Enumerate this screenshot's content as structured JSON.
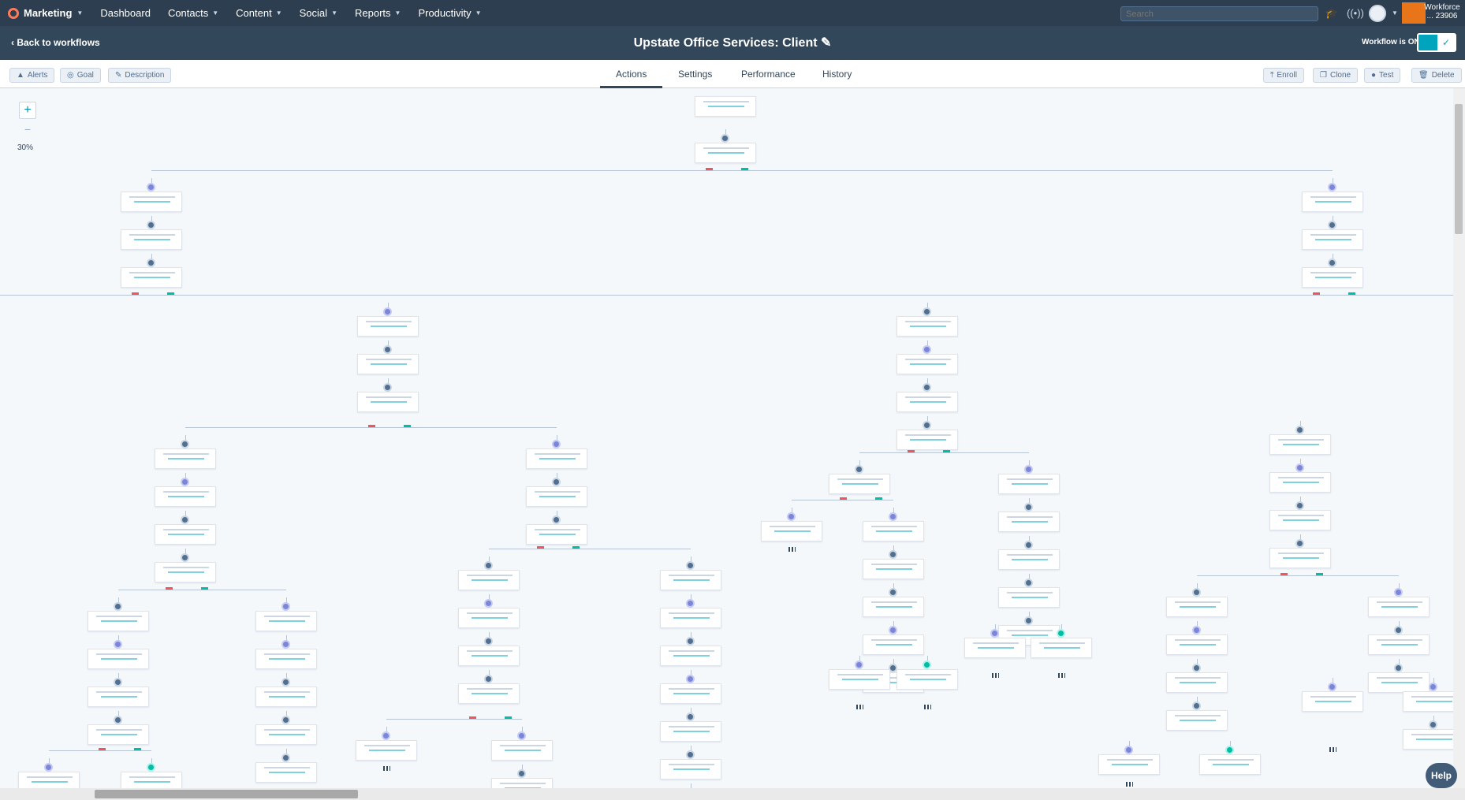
{
  "nav": {
    "brand": "Marketing",
    "items": [
      "Dashboard",
      "Contacts",
      "Content",
      "Social",
      "Reports",
      "Productivity"
    ],
    "search_placeholder": "Search",
    "account": "Workforce ... 23906"
  },
  "header": {
    "back_label": "Back to workflows",
    "title": "Upstate Office Services: Client",
    "status_label": "Workflow is ON"
  },
  "toolbar": {
    "left": [
      "Alerts",
      "Goal",
      "Description"
    ],
    "tabs": [
      "Actions",
      "Settings",
      "Performance",
      "History"
    ],
    "active_tab": "Actions",
    "right": [
      "Enroll",
      "Clone",
      "Test",
      "Delete"
    ]
  },
  "canvas": {
    "zoom_in": "+",
    "zoom_out": "−",
    "zoom_level": "30%"
  },
  "help_label": "Help",
  "colors": {
    "accent": "#00a4bd",
    "brand": "#ff7a59",
    "nav": "#2d3e50",
    "no_branch": "#f2545b",
    "yes_branch": "#00bda5"
  }
}
